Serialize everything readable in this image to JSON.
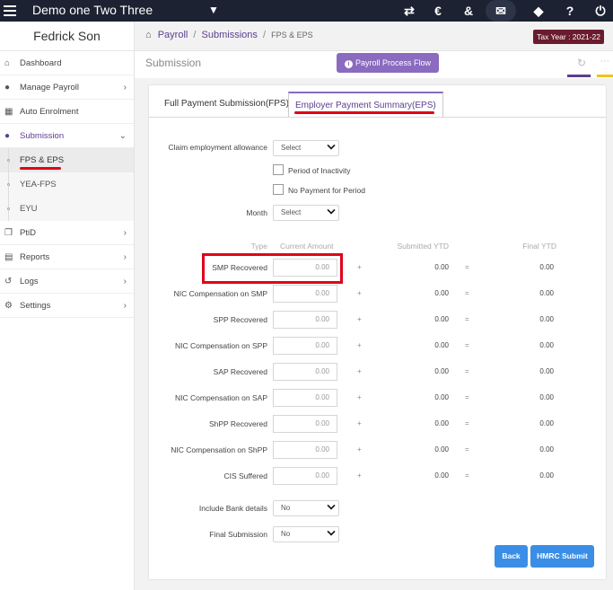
{
  "topbar": {
    "company": "Demo one Two Three",
    "icons": [
      "menu-icon",
      "caret-down-icon",
      "transfer-icon",
      "currency-icon",
      "link-icon",
      "megaphone-icon",
      "tag-icon",
      "help-icon",
      "power-icon"
    ]
  },
  "sidebar": {
    "user": "Fedrick Son",
    "items": [
      {
        "label": "Dashboard",
        "icon": "home-icon"
      },
      {
        "label": "Manage Payroll",
        "icon": "user-icon"
      },
      {
        "label": "Auto Enrolment",
        "icon": "grid-icon"
      },
      {
        "label": "Submission",
        "icon": "users-icon"
      },
      {
        "label": "PtiD",
        "icon": "copy-icon"
      },
      {
        "label": "Reports",
        "icon": "report-icon"
      },
      {
        "label": "Logs",
        "icon": "history-icon"
      },
      {
        "label": "Settings",
        "icon": "gear-icon"
      }
    ],
    "sub_items": [
      {
        "label": "FPS & EPS"
      },
      {
        "label": "YEA-FPS"
      },
      {
        "label": "EYU"
      }
    ]
  },
  "breadcrumb": {
    "root": "Payroll",
    "middle": "Submissions",
    "current": "FPS & EPS"
  },
  "tax_year": "Tax Year : 2021-22",
  "subhead": {
    "title": "Submission",
    "flow_button": "Payroll Process Flow"
  },
  "tabs": {
    "fps": "Full Payment Submission(FPS)",
    "eps": "Employer Payment Summary(EPS)"
  },
  "form": {
    "claim_label": "Claim employment allowance",
    "claim_value": "Select",
    "inactivity_label": "Period of Inactivity",
    "no_payment_label": "No Payment for Period",
    "month_label": "Month",
    "month_value": "Select",
    "columns": {
      "type": "Type",
      "current": "Current Amount",
      "submitted": "Submitted YTD",
      "final": "Final YTD"
    },
    "rows": [
      {
        "label": "SMP Recovered",
        "current": "0.00",
        "submitted": "0.00",
        "final": "0.00"
      },
      {
        "label": "NIC Compensation on SMP",
        "current": "0.00",
        "submitted": "0.00",
        "final": "0.00"
      },
      {
        "label": "SPP Recovered",
        "current": "0.00",
        "submitted": "0.00",
        "final": "0.00"
      },
      {
        "label": "NIC Compensation on SPP",
        "current": "0.00",
        "submitted": "0.00",
        "final": "0.00"
      },
      {
        "label": "SAP Recovered",
        "current": "0.00",
        "submitted": "0.00",
        "final": "0.00"
      },
      {
        "label": "NIC Compensation on SAP",
        "current": "0.00",
        "submitted": "0.00",
        "final": "0.00"
      },
      {
        "label": "ShPP Recovered",
        "current": "0.00",
        "submitted": "0.00",
        "final": "0.00"
      },
      {
        "label": "NIC Compensation on ShPP",
        "current": "0.00",
        "submitted": "0.00",
        "final": "0.00"
      },
      {
        "label": "CIS Suffered",
        "current": "0.00",
        "submitted": "0.00",
        "final": "0.00"
      }
    ],
    "plus": "+",
    "equals": "=",
    "bank_label": "Include Bank details",
    "bank_value": "No",
    "final_label": "Final Submission",
    "final_value": "No"
  },
  "buttons": {
    "back": "Back",
    "submit": "HMRC Submit"
  }
}
